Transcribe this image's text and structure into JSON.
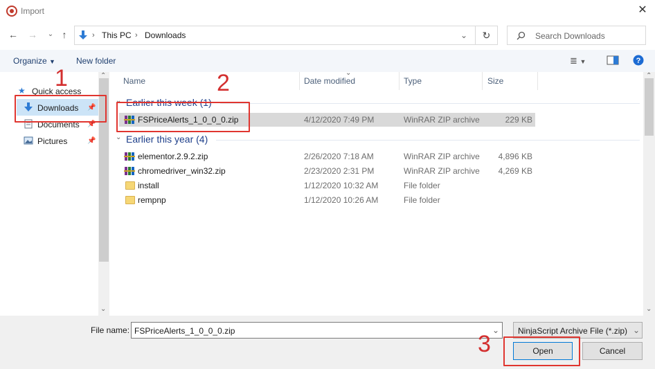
{
  "window": {
    "title": "Import",
    "close_symbol": "✕"
  },
  "nav": {
    "back": "←",
    "forward": "→",
    "recent": "⌄",
    "up": "↑",
    "breadcrumb": [
      "This PC",
      "Downloads"
    ],
    "separator": "›",
    "dropdown": "⌄",
    "refresh": "↻",
    "search_placeholder": "Search Downloads"
  },
  "toolbar": {
    "organize": "Organize",
    "new_folder": "New folder",
    "view_symbol": "≣"
  },
  "sidebar": {
    "items": [
      {
        "label": "Quick access",
        "icon": "star-icon"
      },
      {
        "label": "Downloads",
        "icon": "download-arrow-icon",
        "selected": true
      },
      {
        "label": "Documents",
        "icon": "document-icon"
      },
      {
        "label": "Pictures",
        "icon": "picture-icon"
      }
    ]
  },
  "columns": {
    "name": "Name",
    "date": "Date modified",
    "type": "Type",
    "size": "Size"
  },
  "groups": [
    {
      "label": "Earlier this week (1)",
      "files": [
        {
          "name": "FSPriceAlerts_1_0_0_0.zip",
          "date": "4/12/2020 7:49 PM",
          "type": "WinRAR ZIP archive",
          "size": "229 KB",
          "icon": "zip-archive-icon",
          "selected": true
        }
      ]
    },
    {
      "label": "Earlier this year (4)",
      "files": [
        {
          "name": "elementor.2.9.2.zip",
          "date": "2/26/2020 7:18 AM",
          "type": "WinRAR ZIP archive",
          "size": "4,896 KB",
          "icon": "zip-archive-icon"
        },
        {
          "name": "chromedriver_win32.zip",
          "date": "2/23/2020 2:31 PM",
          "type": "WinRAR ZIP archive",
          "size": "4,269 KB",
          "icon": "zip-archive-icon"
        },
        {
          "name": "install",
          "date": "1/12/2020 10:32 AM",
          "type": "File folder",
          "size": "",
          "icon": "folder-icon"
        },
        {
          "name": "rempnp",
          "date": "1/12/2020 10:26 AM",
          "type": "File folder",
          "size": "",
          "icon": "folder-icon"
        }
      ]
    }
  ],
  "footer": {
    "file_name_label": "File name:",
    "file_name_value": "FSPriceAlerts_1_0_0_0.zip",
    "file_type": "NinjaScript Archive File (*.zip)",
    "open": "Open",
    "cancel": "Cancel"
  },
  "annotations": {
    "step1": "1",
    "step2": "2",
    "step3": "3"
  },
  "colors": {
    "highlight": "#e0352f",
    "selection": "#d9d9d9",
    "group_text": "#1e3f8a",
    "accent_blue": "#2d7bd4"
  }
}
